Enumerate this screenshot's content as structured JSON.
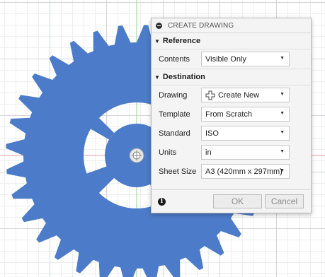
{
  "dialog": {
    "title": "CREATE DRAWING",
    "reference": {
      "header": "Reference",
      "contents_label": "Contents",
      "contents_value": "Visible Only"
    },
    "destination": {
      "header": "Destination",
      "drawing_label": "Drawing",
      "drawing_value": "Create New",
      "template_label": "Template",
      "template_value": "From Scratch",
      "standard_label": "Standard",
      "standard_value": "ISO",
      "units_label": "Units",
      "units_value": "in",
      "sheet_size_label": "Sheet Size",
      "sheet_size_value": "A3 (420mm x 297mm)"
    },
    "ok_label": "OK",
    "cancel_label": "Cancel"
  },
  "viewport": {
    "gear_color": "#4c7bc9",
    "grid_color": "#d4d6d9",
    "axis_red": "#e8a0a0",
    "axis_green": "#8fd68f",
    "origin_icon": "origin-marker-icon"
  }
}
